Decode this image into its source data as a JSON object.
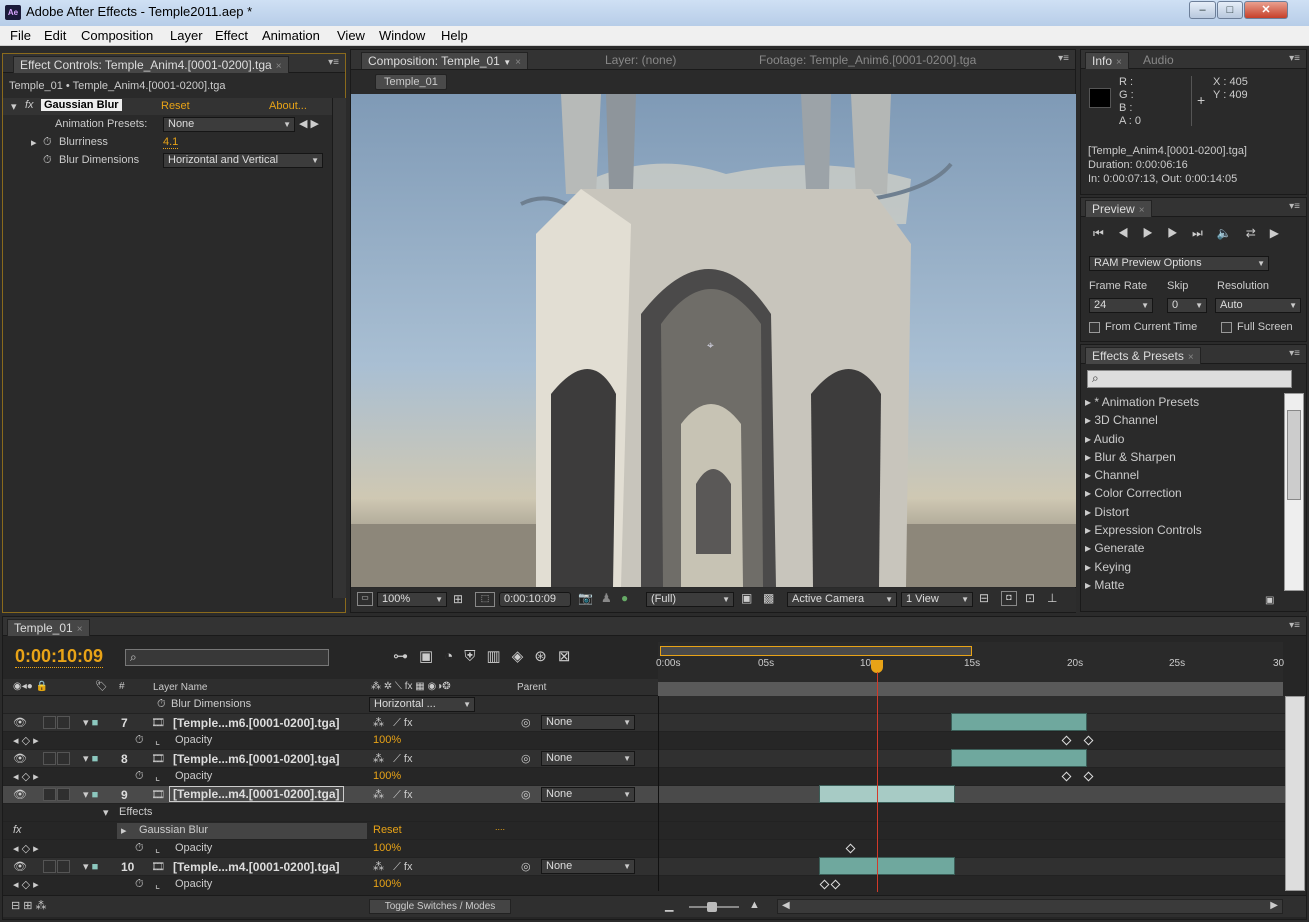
{
  "window": {
    "app_icon": "Ae",
    "title": "Adobe After Effects - Temple2011.aep *",
    "minimize": "–",
    "maximize": "□",
    "close": "✕"
  },
  "menu": [
    "File",
    "Edit",
    "Composition",
    "Layer",
    "Effect",
    "Animation",
    "View",
    "Window",
    "Help"
  ],
  "effect_controls": {
    "tab": "Effect Controls: Temple_Anim4.[0001-0200].tga",
    "breadcrumb": "Temple_01 • Temple_Anim4.[0001-0200].tga",
    "effect_name": "Gaussian Blur",
    "reset": "Reset",
    "about": "About...",
    "presets_label": "Animation Presets:",
    "presets_value": "None",
    "blurriness_label": "Blurriness",
    "blurriness_value": "4.1",
    "dimensions_label": "Blur Dimensions",
    "dimensions_value": "Horizontal and Vertical"
  },
  "composition": {
    "tab": "Composition: Temple_01",
    "layer_tab": "Layer: (none)",
    "footage_tab": "Footage: Temple_Anim6.[0001-0200].tga",
    "comp_button": "Temple_01",
    "zoom": "100%",
    "timecode": "0:00:10:09",
    "resolution": "(Full)",
    "camera": "Active Camera",
    "views": "1 View"
  },
  "info": {
    "tab": "Info",
    "audio_tab": "Audio",
    "r": "R :",
    "g": "G :",
    "b": "B :",
    "a": "A : 0",
    "x": "X : 405",
    "y": "Y : 409",
    "file": "[Temple_Anim4.[0001-0200].tga]",
    "duration": "Duration: 0:00:06:16",
    "inout": "In: 0:00:07:13, Out: 0:00:14:05",
    "swatch_color": "#000000"
  },
  "preview": {
    "tab": "Preview",
    "options": "RAM Preview Options",
    "frame_rate_label": "Frame Rate",
    "skip_label": "Skip",
    "resolution_label": "Resolution",
    "frame_rate": "24",
    "skip": "0",
    "resolution": "Auto",
    "from_current": "From Current Time",
    "full_screen": "Full Screen"
  },
  "effects_presets": {
    "tab": "Effects & Presets",
    "items": [
      "* Animation Presets",
      "3D Channel",
      "Audio",
      "Blur & Sharpen",
      "Channel",
      "Color Correction",
      "Distort",
      "Expression Controls",
      "Generate",
      "Keying",
      "Matte"
    ]
  },
  "timeline": {
    "tab": "Temple_01",
    "timecode": "0:00:10:09",
    "col_layer_name": "Layer Name",
    "col_parent": "Parent",
    "col_hash": "#",
    "ruler": [
      "0:00s",
      "05s",
      "10s",
      "15s",
      "20s",
      "25s",
      "30"
    ],
    "blur_dim_label": "Blur Dimensions",
    "blur_dim_value": "Horizontal ...",
    "layers": [
      {
        "num": "7",
        "name": "[Temple...m6.[0001-0200].tga]",
        "parent": "None",
        "prop": "Opacity",
        "prop_value": "100%"
      },
      {
        "num": "8",
        "name": "[Temple...m6.[0001-0200].tga]",
        "parent": "None",
        "prop": "Opacity",
        "prop_value": "100%"
      },
      {
        "num": "9",
        "name": "[Temple...m4.[0001-0200].tga]",
        "parent": "None",
        "effects_label": "Effects",
        "effect": "Gaussian Blur",
        "effect_reset": "Reset",
        "effect_dots": "....",
        "prop": "Opacity",
        "prop_value": "100%"
      },
      {
        "num": "10",
        "name": "[Temple...m4.[0001-0200].tga]",
        "parent": "None",
        "prop": "Opacity",
        "prop_value": "100%"
      }
    ],
    "toggle": "Toggle Switches / Modes"
  },
  "colors": {
    "accent": "#e8a317",
    "bar": "#6fa89e",
    "playhead": "#d23a2a"
  }
}
